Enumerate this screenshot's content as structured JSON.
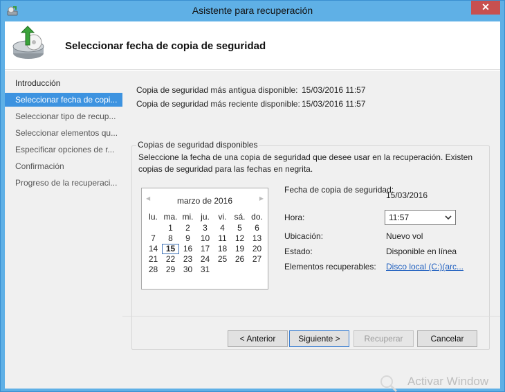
{
  "window": {
    "title": "Asistente para recuperación",
    "close_label": "✕"
  },
  "header": {
    "title": "Seleccionar fecha de copia de seguridad"
  },
  "nav": {
    "items": [
      {
        "label": "Introducción"
      },
      {
        "label": "Seleccionar fecha de copi..."
      },
      {
        "label": "Seleccionar tipo de recup..."
      },
      {
        "label": "Seleccionar elementos qu..."
      },
      {
        "label": "Especificar opciones de r..."
      },
      {
        "label": "Confirmación"
      },
      {
        "label": "Progreso de la recuperaci..."
      }
    ],
    "active_index": 1
  },
  "info": {
    "oldest_label": "Copia de seguridad más antigua disponible:",
    "oldest_value": "15/03/2016 11:57",
    "newest_label": "Copia de seguridad más reciente disponible:",
    "newest_value": "15/03/2016 11:57"
  },
  "group": {
    "title": "Copias de seguridad disponibles",
    "description": "Seleccione la fecha de una copia de seguridad que desee usar en la recuperación. Existen copias de seguridad para las fechas en negrita."
  },
  "calendar": {
    "prev_label": "◀",
    "next_label": "▶",
    "month_label": "marzo de 2016",
    "weekdays": [
      "lu.",
      "ma.",
      "mi.",
      "ju.",
      "vi.",
      "sá.",
      "do."
    ],
    "weeks": [
      [
        "",
        "1",
        "2",
        "3",
        "4",
        "5",
        "6"
      ],
      [
        "7",
        "8",
        "9",
        "10",
        "11",
        "12",
        "13"
      ],
      [
        "14",
        "15",
        "16",
        "17",
        "18",
        "19",
        "20"
      ],
      [
        "21",
        "22",
        "23",
        "24",
        "25",
        "26",
        "27"
      ],
      [
        "28",
        "29",
        "30",
        "31",
        "",
        "",
        ""
      ]
    ],
    "selected_day": "15"
  },
  "details": {
    "date_label": "Fecha de copia de seguridad:",
    "date_value": "15/03/2016",
    "time_label": "Hora:",
    "time_value": "11:57",
    "location_label": "Ubicación:",
    "location_value": "Nuevo vol",
    "status_label": "Estado:",
    "status_value": "Disponible en línea",
    "items_label": "Elementos recuperables:",
    "items_value": "Disco local (C:)(arc..."
  },
  "buttons": {
    "back": "< Anterior",
    "next": "Siguiente >",
    "recover": "Recuperar",
    "cancel": "Cancelar"
  },
  "watermark": {
    "text": "Activar Window"
  }
}
